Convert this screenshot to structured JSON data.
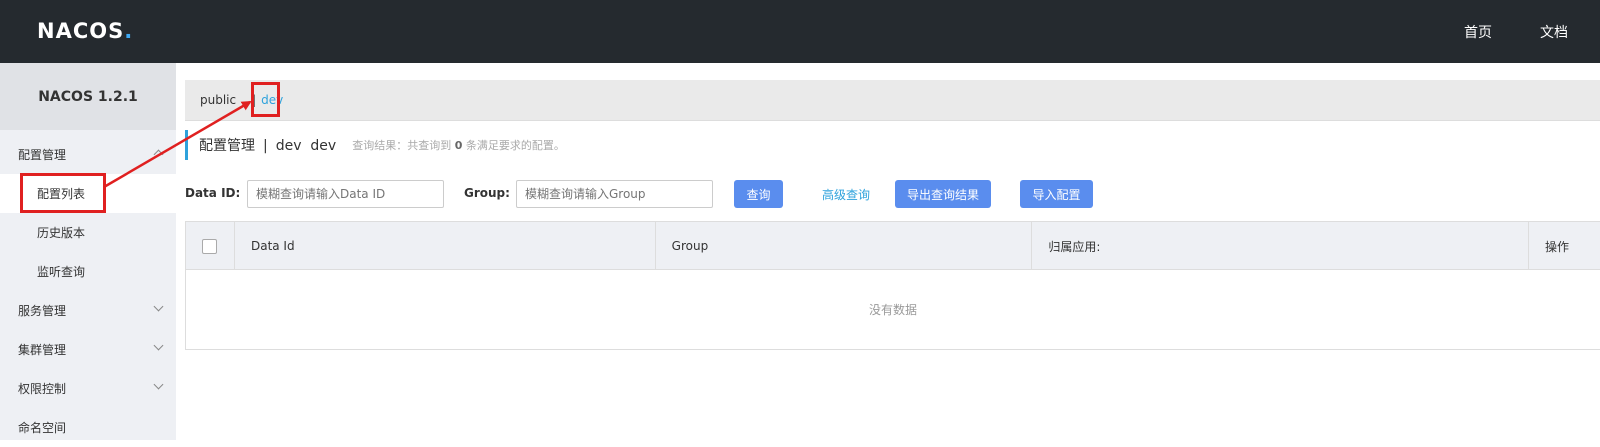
{
  "header": {
    "logo": "NACOS.",
    "nav": [
      "首页",
      "文档"
    ]
  },
  "sidebar": {
    "version": "NACOS 1.2.1",
    "groups": [
      {
        "label": "配置管理",
        "expanded": true,
        "items": [
          "配置列表",
          "历史版本",
          "监听查询"
        ]
      },
      {
        "label": "服务管理",
        "expanded": false
      },
      {
        "label": "集群管理",
        "expanded": false
      },
      {
        "label": "权限控制",
        "expanded": false
      },
      {
        "label": "命名空间"
      }
    ]
  },
  "namespaces": {
    "items": [
      "public",
      "dev"
    ],
    "separator": "|",
    "current": "dev"
  },
  "page": {
    "title": "配置管理",
    "separator": "|",
    "ns_name": "dev",
    "ns_id": "dev",
    "result_prefix": "查询结果：共查询到",
    "result_count": "0",
    "result_suffix": "条满足要求的配置。"
  },
  "search": {
    "dataid_label": "Data ID:",
    "dataid_placeholder": "模糊查询请输入Data ID",
    "group_label": "Group:",
    "group_placeholder": "模糊查询请输入Group",
    "query_button": "查询",
    "advanced_link": "高级查询",
    "export_button": "导出查询结果",
    "import_button": "导入配置"
  },
  "table": {
    "columns": [
      "Data Id",
      "Group",
      "归属应用:",
      "操作"
    ],
    "empty_text": "没有数据"
  },
  "colors": {
    "topbar": "#252a2f",
    "accent": "#2ea2dc",
    "button": "#5a8dee",
    "annotation": "#e02020"
  }
}
